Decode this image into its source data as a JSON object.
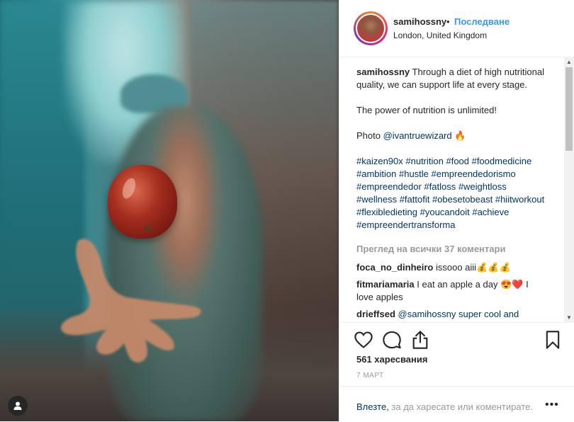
{
  "post": {
    "username": "samihossny",
    "dot": "•",
    "follow_label": "Последване",
    "location": "London, United Kingdom",
    "caption": {
      "username": "samihossny",
      "line1": "Through a diet of high nutritional quality, we can support life at every stage.",
      "line2": "The power of nutrition is unlimited!",
      "photo_prefix": "Photo",
      "photo_mention": "@ivantruewizard",
      "photo_emoji": "🔥",
      "hashtags": "#kaizen90x #nutrition #food #foodmedicine #ambition #hustle #empreendedorismo #empreendedor #fatloss #weightloss #wellness #fattofit #obesetobeast #hiitworkout #flexibledieting #youcandoit #achieve #empreendertransforma"
    },
    "view_all_comments": "Преглед на всички 37 коментари",
    "comments": [
      {
        "user": "foca_no_dinheiro",
        "text": "issooo aiii💰💰💰"
      },
      {
        "user": "fitmariamaria",
        "text": "I eat an apple a day 😍❤️ I love apples"
      },
      {
        "user": "drieffsed",
        "text": "@samihossny super cool and"
      }
    ],
    "likes": "561 харесвания",
    "date": "7 МАРТ",
    "login_link": "Влезте,",
    "login_rest": " за да харесате или коментирате.",
    "more": "•••"
  },
  "icons": {
    "like": "heart-icon",
    "comment": "comment-icon",
    "share": "share-icon",
    "save": "bookmark-icon",
    "user": "user-icon"
  },
  "colors": {
    "accent": "#3897f0",
    "link": "#003569",
    "muted": "#999999",
    "text": "#262626"
  }
}
